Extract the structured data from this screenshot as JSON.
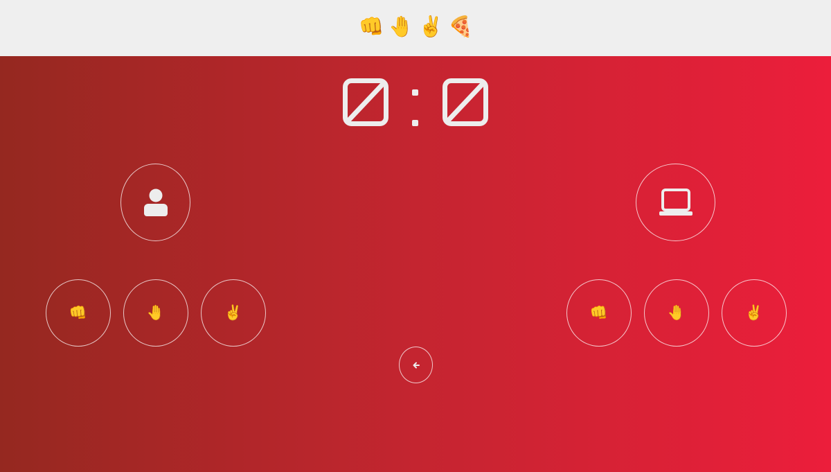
{
  "header": {
    "logo_emojis": [
      "👊",
      "🤚",
      "✌️",
      "🍕"
    ]
  },
  "scoreboard": {
    "player_score_icon": "empty-set-icon",
    "computer_score_icon": "empty-set-icon",
    "separator": ":"
  },
  "player": {
    "avatar_icon": "user-icon",
    "choices": [
      {
        "emoji": "👊",
        "icon": "rock-fist-icon"
      },
      {
        "emoji": "🤚",
        "icon": "paper-hand-icon"
      },
      {
        "emoji": "✌️",
        "icon": "scissors-victory-icon"
      }
    ]
  },
  "computer": {
    "avatar_icon": "laptop-icon",
    "choices": [
      {
        "emoji": "👊",
        "icon": "rock-fist-icon"
      },
      {
        "emoji": "🤚",
        "icon": "paper-hand-icon"
      },
      {
        "emoji": "✌️",
        "icon": "scissors-victory-icon"
      }
    ]
  },
  "controls": {
    "back_icon": "arrow-left-icon"
  },
  "colors": {
    "header_bg": "#efefef",
    "gradient_start": "#952820",
    "gradient_mid": "#c42530",
    "gradient_end": "#ec1e3b",
    "icon_fg": "#ededed"
  }
}
